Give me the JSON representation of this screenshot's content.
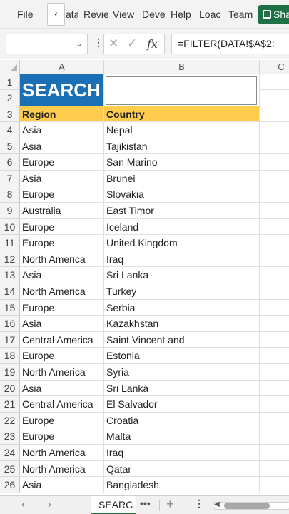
{
  "ribbon": {
    "tabs": [
      "File",
      "ata",
      "Revie",
      "View",
      "Deve",
      "Help",
      "Loac",
      "Team"
    ],
    "back_glyph": "‹",
    "share_label": "Sha"
  },
  "formula_bar": {
    "name_box_value": "",
    "cancel_icon": "✕",
    "confirm_icon": "✓",
    "fx_label": "fx",
    "formula": "=FILTER(DATA!$A$2:"
  },
  "grid": {
    "columns": [
      "A",
      "B",
      "C"
    ],
    "search_label": "SEARCH",
    "search_input_value": "",
    "header_row": {
      "row": "3",
      "region": "Region",
      "country": "Country"
    },
    "rows": [
      {
        "row": "4",
        "region": "Asia",
        "country": "Nepal"
      },
      {
        "row": "5",
        "region": "Asia",
        "country": "Tajikistan"
      },
      {
        "row": "6",
        "region": "Europe",
        "country": "San Marino"
      },
      {
        "row": "7",
        "region": "Asia",
        "country": "Brunei"
      },
      {
        "row": "8",
        "region": "Europe",
        "country": "Slovakia"
      },
      {
        "row": "9",
        "region": "Australia",
        "country": "East Timor"
      },
      {
        "row": "10",
        "region": "Europe",
        "country": "Iceland"
      },
      {
        "row": "11",
        "region": "Europe",
        "country": "United Kingdom"
      },
      {
        "row": "12",
        "region": "North America",
        "country": "Iraq"
      },
      {
        "row": "13",
        "region": "Asia",
        "country": "Sri Lanka"
      },
      {
        "row": "14",
        "region": "North America",
        "country": "Turkey"
      },
      {
        "row": "15",
        "region": "Europe",
        "country": "Serbia"
      },
      {
        "row": "16",
        "region": "Asia",
        "country": "Kazakhstan"
      },
      {
        "row": "17",
        "region": "Central America",
        "country": "Saint Vincent and"
      },
      {
        "row": "18",
        "region": "Europe",
        "country": "Estonia"
      },
      {
        "row": "19",
        "region": "North America",
        "country": "Syria"
      },
      {
        "row": "20",
        "region": "Asia",
        "country": "Sri Lanka"
      },
      {
        "row": "21",
        "region": "Central America",
        "country": "El Salvador"
      },
      {
        "row": "22",
        "region": "Europe",
        "country": "Croatia"
      },
      {
        "row": "23",
        "region": "Europe",
        "country": "Malta"
      },
      {
        "row": "24",
        "region": "North America",
        "country": "Iraq"
      },
      {
        "row": "25",
        "region": "North America",
        "country": "Qatar"
      },
      {
        "row": "26",
        "region": "Asia",
        "country": "Bangladesh"
      }
    ]
  },
  "sheet_bar": {
    "prev_icon": "‹",
    "next_icon": "›",
    "active_sheet": "SEARC",
    "more_icon": "•••",
    "add_icon": "+",
    "menu_icon": "⋮"
  },
  "colors": {
    "search_fill": "#1b6fb5",
    "header_fill": "#ffcc4d",
    "share_green": "#1e7145"
  }
}
